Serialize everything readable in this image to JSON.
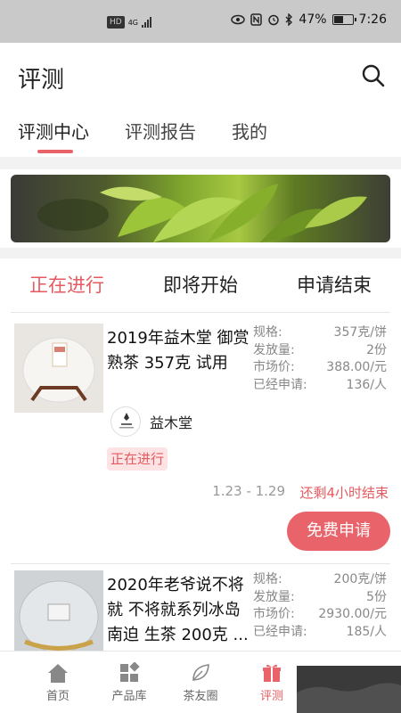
{
  "status_bar": {
    "network_badge": "HD",
    "network_type": "4G",
    "battery": "47%",
    "time": "7:26"
  },
  "header": {
    "title": "评测"
  },
  "tabs": [
    {
      "label": "评测中心"
    },
    {
      "label": "评测报告"
    },
    {
      "label": "我的"
    }
  ],
  "subtabs": [
    {
      "label": "正在进行"
    },
    {
      "label": "即将开始"
    },
    {
      "label": "申请结束"
    }
  ],
  "items": [
    {
      "title": "2019年益木堂 御赏 熟茶 357克 试用",
      "specs": [
        {
          "label": "规格:",
          "value": "357克/饼"
        },
        {
          "label": "发放量:",
          "value": "2份"
        },
        {
          "label": "市场价:",
          "value": "388.00/元"
        },
        {
          "label": "已经申请:",
          "value": "136/人"
        }
      ],
      "brand": "益木堂",
      "status": "正在进行",
      "dates": "1.23 - 1.29",
      "remaining": "还剩4小时结束",
      "button": "免费申请"
    },
    {
      "title": "2020年老爷说不将就 不将就系列冰岛南迫 生茶 200克 ...",
      "specs": [
        {
          "label": "规格:",
          "value": "200克/饼"
        },
        {
          "label": "发放量:",
          "value": "5份"
        },
        {
          "label": "市场价:",
          "value": "2930.00/元"
        },
        {
          "label": "已经申请:",
          "value": "185/人"
        }
      ]
    }
  ],
  "bottom_nav": [
    {
      "label": "首页",
      "icon": "home-icon"
    },
    {
      "label": "产品库",
      "icon": "grid-icon"
    },
    {
      "label": "茶友圈",
      "icon": "leaf-icon"
    },
    {
      "label": "评测",
      "icon": "gift-icon"
    }
  ]
}
